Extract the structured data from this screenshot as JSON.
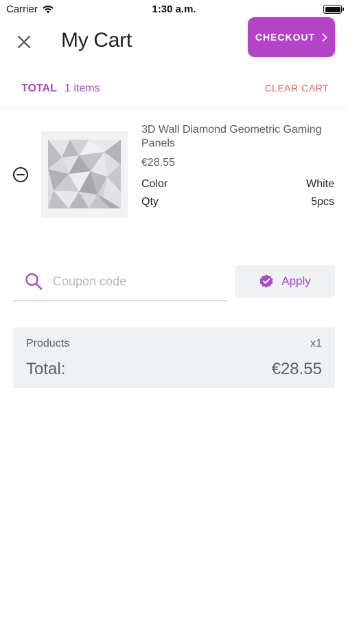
{
  "status_bar": {
    "carrier": "Carrier",
    "time": "1:30 a.m.",
    "icons": [
      "wifi-icon",
      "battery-icon"
    ]
  },
  "header": {
    "title": "My Cart",
    "close_icon": "close-icon",
    "checkout_label": "CHECKOUT",
    "checkout_icon": "chevron-right-icon"
  },
  "total_bar": {
    "label": "TOTAL",
    "count": "1 items",
    "clear_label": "CLEAR CART"
  },
  "cart_items": [
    {
      "name": "3D Wall Diamond Geometric Gaming Panels",
      "price": "€28.55",
      "attributes": [
        {
          "name": "Color",
          "value": "White"
        },
        {
          "name": "Qty",
          "value": "5pcs"
        }
      ],
      "remove_icon": "remove-circle-icon",
      "image": "product-thumbnail"
    }
  ],
  "coupon": {
    "placeholder": "Coupon code",
    "value": "",
    "icon": "search-icon",
    "apply_label": "Apply",
    "apply_icon": "verified-badge-icon"
  },
  "summary": {
    "products_label": "Products",
    "products_qty": "x1",
    "total_label": "Total:",
    "total_value": "€28.55"
  },
  "colors": {
    "accent": "#b244c5",
    "accent_text": "#a24cc0",
    "danger": "#e0605c",
    "panel": "#f0f1f3"
  }
}
